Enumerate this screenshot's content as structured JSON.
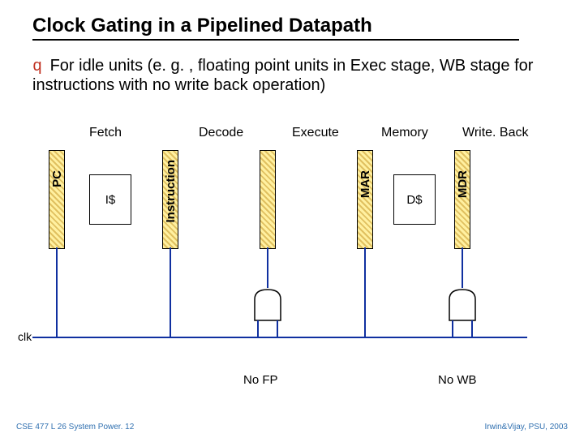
{
  "title": "Clock Gating in a Pipelined Datapath",
  "bullet": "For idle units (e. g. , floating point units in Exec stage, WB stage for instructions with no write back operation)",
  "stages": {
    "fetch": "Fetch",
    "decode": "Decode",
    "execute": "Execute",
    "memory": "Memory",
    "writeback": "Write. Back"
  },
  "regs": {
    "pc": "PC",
    "instruction": "Instruction",
    "mar": "MAR",
    "mdr": "MDR"
  },
  "boxes": {
    "icache": "I$",
    "dcache": "D$"
  },
  "clk": "clk",
  "gates": {
    "nofp": "No FP",
    "nowb": "No WB"
  },
  "footer": {
    "left": "CSE 477 L 26 System Power. 12",
    "right": "Irwin&Vijay, PSU, 2003"
  },
  "chart_data": {
    "type": "diagram",
    "description": "Pipelined datapath with clock-gated Execute and WriteBack registers",
    "pipeline_stages": [
      "Fetch",
      "Decode",
      "Execute",
      "Memory",
      "WriteBack"
    ],
    "pipeline_registers": [
      {
        "name": "PC",
        "between": [
          "",
          "Fetch"
        ]
      },
      {
        "name": "Instruction",
        "between": [
          "Fetch",
          "Decode"
        ]
      },
      {
        "name": "(unnamed)",
        "between": [
          "Decode",
          "Execute"
        ]
      },
      {
        "name": "MAR",
        "between": [
          "Execute",
          "Memory"
        ]
      },
      {
        "name": "MDR",
        "between": [
          "Memory",
          "WriteBack"
        ]
      }
    ],
    "functional_blocks": [
      {
        "name": "I$",
        "stage": "Fetch"
      },
      {
        "name": "D$",
        "stage": "Memory"
      }
    ],
    "clock_signal": "clk",
    "clock_gating": [
      {
        "gate": "AND",
        "inputs": [
          "clk",
          "No FP"
        ],
        "gated_register_before_stage": "Execute"
      },
      {
        "gate": "AND",
        "inputs": [
          "clk",
          "No WB"
        ],
        "gated_register_before_stage": "WriteBack"
      }
    ]
  }
}
